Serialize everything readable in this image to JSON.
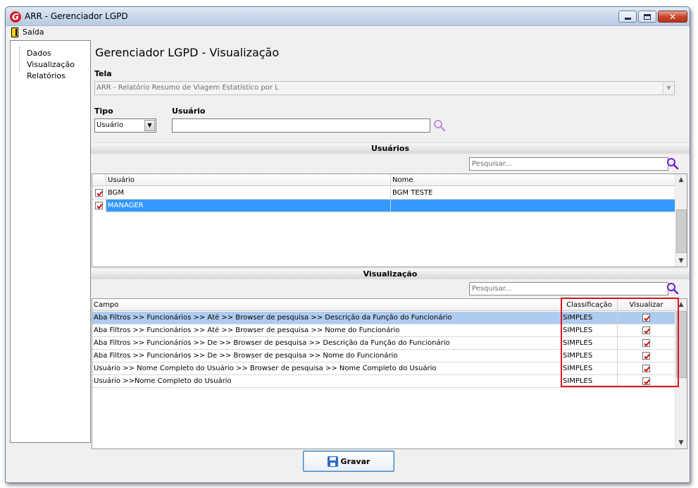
{
  "window": {
    "title": "ARR - Gerenciador LGPD",
    "app_icon_letter": "G"
  },
  "menu": {
    "exit_label": "Saída"
  },
  "tree": {
    "items": [
      "Dados",
      "Visualização",
      "Relatórios"
    ]
  },
  "page": {
    "title": "Gerenciador LGPD - Visualização"
  },
  "form": {
    "screen_label": "Tela",
    "screen_value": "ARR - Relatório Resumo de Viagem Estatístico por L",
    "type_label": "Tipo",
    "type_value": "Usuário",
    "user_label": "Usuário",
    "user_value": ""
  },
  "users_section": {
    "title": "Usuários",
    "search_placeholder": "Pesquisar...",
    "columns": [
      "Usuário",
      "Nome"
    ],
    "rows": [
      {
        "user": "BGM",
        "name": "BGM TESTE",
        "checked": true,
        "selected": false
      },
      {
        "user": "MANAGER",
        "name": "",
        "checked": true,
        "selected": true
      }
    ]
  },
  "view_section": {
    "title": "Visualização",
    "search_placeholder": "Pesquisar...",
    "columns": [
      "Campo",
      "Classificação",
      "Visualizar"
    ],
    "rows": [
      {
        "field": "Aba Filtros >> Funcionários >> Até >> Browser de pesquisa >> Descrição da Função do Funcionário",
        "class": "SIMPLES",
        "view": true
      },
      {
        "field": "Aba Filtros >> Funcionários >> Até >> Browser de pesquisa >> Nome do Funcionário",
        "class": "SIMPLES",
        "view": true
      },
      {
        "field": "Aba Filtros >> Funcionários >> De >> Browser de pesquisa >> Descrição da Função do Funcionário",
        "class": "SIMPLES",
        "view": true
      },
      {
        "field": "Aba Filtros >> Funcionários >> De >> Browser de pesquisa >> Nome do Funcionário",
        "class": "SIMPLES",
        "view": true
      },
      {
        "field": "Usuário >> Nome Completo do Usuário >> Browser de pesquisa >> Nome Completo do Usuário",
        "class": "SIMPLES",
        "view": true
      },
      {
        "field": "Usuário >>Nome Completo do Usuário",
        "class": "SIMPLES",
        "view": true
      }
    ]
  },
  "actions": {
    "save_label": "Gravar"
  },
  "colors": {
    "selection": "#3399ff",
    "selection_light": "#aecbf0",
    "highlight_border": "#e0141e",
    "checkmark": "#d10d0d",
    "search_icon": "#6a1fd6"
  },
  "icons": {
    "exit": "door-exit-icon",
    "search": "magnifier-icon",
    "save": "floppy-disk-icon"
  }
}
